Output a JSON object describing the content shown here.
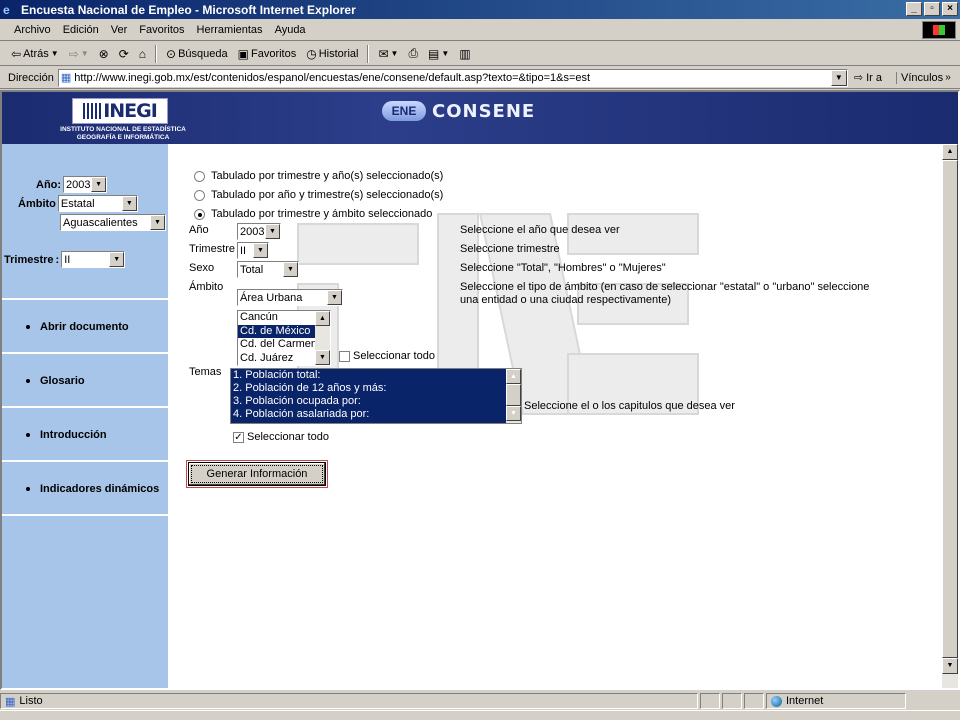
{
  "window": {
    "title": "Encuesta Nacional de Empleo - Microsoft Internet Explorer",
    "min": "_",
    "max": "▫",
    "close": "×"
  },
  "menu": [
    "Archivo",
    "Edición",
    "Ver",
    "Favoritos",
    "Herramientas",
    "Ayuda"
  ],
  "toolbar": {
    "back": "Atrás",
    "search": "Búsqueda",
    "favorites": "Favoritos",
    "history": "Historial"
  },
  "address": {
    "label": "Dirección",
    "url": "http://www.inegi.gob.mx/est/contenidos/espanol/encuestas/ene/consene/default.asp?texto=&tipo=1&s=est",
    "go": "Ir a",
    "links": "Vínculos"
  },
  "banner": {
    "logo": "INEGI",
    "logo_sub_1": "INSTITUTO NACIONAL DE ESTADÍSTICA",
    "logo_sub_2": "GEOGRAFÍA E INFORMÁTICA",
    "emblem": "ENE",
    "product": "CONSENE"
  },
  "sidebar": {
    "anio_label": "Año:",
    "anio_value": "2003",
    "ambito_label": "Ámbito",
    "ambito_value": "Estatal",
    "entidad_value": "Aguascalientes",
    "trimestre_label": "Trimestre",
    "trimestre_value": "II",
    "links": [
      "Abrir documento",
      "Glosario",
      "Introducción",
      "Indicadores dinámicos"
    ]
  },
  "main": {
    "radios": [
      "Tabulado por trimestre y año(s) seleccionado(s)",
      "Tabulado por año y trimestre(s) seleccionado(s)",
      "Tabulado por trimestre y ámbito seleccionado"
    ],
    "anio_label": "Año",
    "anio_value": "2003",
    "anio_hint": "Seleccione el año que desea ver",
    "trimestre_label": "Trimestre",
    "trimestre_value": "II",
    "trimestre_hint": "Seleccione trimestre",
    "sexo_label": "Sexo",
    "sexo_value": "Total",
    "sexo_hint": "Seleccione \"Total\", \"Hombres\" o \"Mujeres\"",
    "ambito_label": "Ámbito",
    "ambito_value": "Área Urbana",
    "ambito_hint": "Seleccione el tipo de ámbito (en caso de seleccionar \"estatal\" o \"urbano\" seleccione una entidad o una ciudad respectivamente)",
    "cities": [
      "Cancún",
      "Cd. de México",
      "Cd. del Carmen",
      "Cd. Juárez"
    ],
    "select_all": "Seleccionar todo",
    "temas_label": "Temas",
    "temas": [
      "1. Población total:",
      "2. Población de 12 años y más:",
      "3. Población ocupada por:",
      "4. Población asalariada por:"
    ],
    "temas_hint": "Seleccione el o los capitulos que desea ver",
    "temas_select_all": "Seleccionar todo",
    "generate": "Generar Información"
  },
  "status": {
    "text": "Listo",
    "zone": "Internet"
  }
}
